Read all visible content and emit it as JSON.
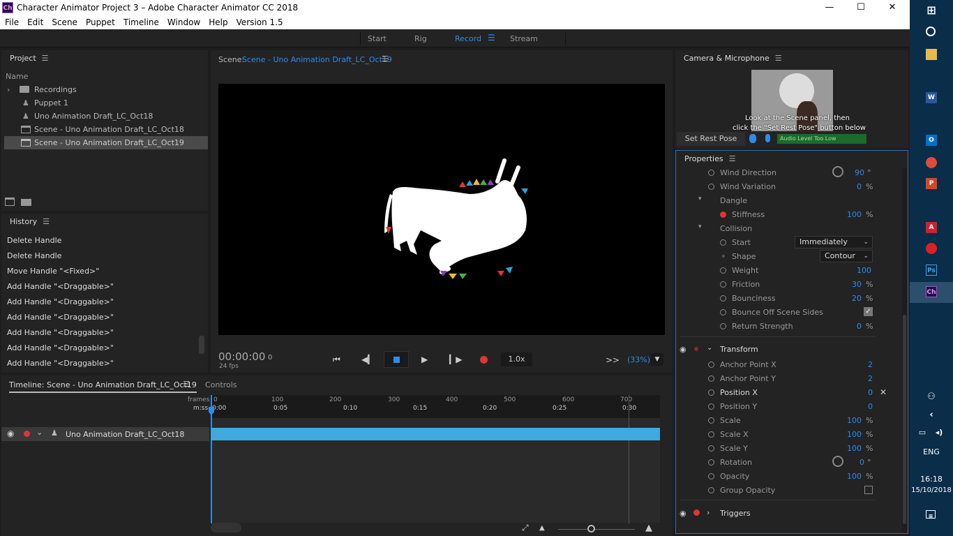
{
  "window": {
    "title": "Character Animator Project 3 – Adobe Character Animator CC 2018",
    "app_icon": "Ch",
    "buttons": {
      "minimize": "—",
      "maximize": "☐",
      "close": "✕"
    }
  },
  "menu": [
    "File",
    "Edit",
    "Scene",
    "Puppet",
    "Timeline",
    "Window",
    "Help",
    "Version 1.5"
  ],
  "workspaces": {
    "start": "Start",
    "rig": "Rig",
    "record": "Record",
    "stream": "Stream"
  },
  "project": {
    "title": "Project",
    "column": "Name",
    "items": [
      {
        "label": "Recordings",
        "type": "folder"
      },
      {
        "label": "Puppet 1",
        "type": "puppet"
      },
      {
        "label": "Uno Animation Draft_LC_Oct18",
        "type": "puppet"
      },
      {
        "label": "Scene - Uno Animation Draft_LC_Oct18",
        "type": "scene"
      },
      {
        "label": "Scene - Uno Animation Draft_LC_Oct19",
        "type": "scene",
        "selected": true
      }
    ]
  },
  "history": {
    "title": "History",
    "items": [
      "Delete Handle",
      "Delete Handle",
      "Move Handle \"<Fixed>\"",
      "Add Handle \"<Draggable>\"",
      "Add Handle \"<Draggable>\"",
      "Add Handle \"<Draggable>\"",
      "Add Handle \"<Draggable>\"",
      "Add Handle \"<Draggable>\"",
      "Add Handle \"<Draggable>\""
    ]
  },
  "scene": {
    "label": "Scene:",
    "name": "Scene - Uno Animation Draft_LC_Oct19",
    "timecode": "00:00:00",
    "frame": "0",
    "fps": "24 fps",
    "speed": "1.0x",
    "zoom": "(33%)",
    "more": ">>"
  },
  "camera": {
    "title": "Camera & Microphone",
    "hint_line1": "Look at the Scene panel, then",
    "hint_line2": "click the \"Set Rest Pose\" button below",
    "set_rest_pose": "Set Rest Pose",
    "audio_level": "Audio Level Too Low"
  },
  "properties": {
    "title": "Properties",
    "rows": {
      "wind_direction": {
        "label": "Wind Direction",
        "value": "90",
        "unit": "°"
      },
      "wind_variation": {
        "label": "Wind Variation",
        "value": "0",
        "unit": "%"
      },
      "dangle": {
        "label": "Dangle"
      },
      "stiffness": {
        "label": "Stiffness",
        "value": "100",
        "unit": "%"
      },
      "collision": {
        "label": "Collision"
      },
      "start": {
        "label": "Start",
        "value": "Immediately"
      },
      "shape": {
        "label": "Shape",
        "value": "Contour"
      },
      "weight": {
        "label": "Weight",
        "value": "100"
      },
      "friction": {
        "label": "Friction",
        "value": "30",
        "unit": "%"
      },
      "bounciness": {
        "label": "Bounciness",
        "value": "20",
        "unit": "%"
      },
      "bounce_off": {
        "label": "Bounce Off Scene Sides",
        "checked": true
      },
      "return_strength": {
        "label": "Return Strength",
        "value": "0",
        "unit": "%"
      },
      "transform": {
        "label": "Transform"
      },
      "anchor_x": {
        "label": "Anchor Point X",
        "value": "2"
      },
      "anchor_y": {
        "label": "Anchor Point Y",
        "value": "2"
      },
      "position_x": {
        "label": "Position X",
        "value": "0"
      },
      "position_y": {
        "label": "Position Y",
        "value": "0"
      },
      "scale": {
        "label": "Scale",
        "value": "100",
        "unit": "%"
      },
      "scale_x": {
        "label": "Scale X",
        "value": "100",
        "unit": "%"
      },
      "scale_y": {
        "label": "Scale Y",
        "value": "100",
        "unit": "%"
      },
      "rotation": {
        "label": "Rotation",
        "value": "0",
        "unit": "°"
      },
      "opacity": {
        "label": "Opacity",
        "value": "100",
        "unit": "%"
      },
      "group_opacity": {
        "label": "Group Opacity",
        "checked": false
      },
      "triggers": {
        "label": "Triggers"
      }
    }
  },
  "timeline": {
    "title": "Timeline: Scene - Uno Animation Draft_LC_Oct19",
    "controls_tab": "Controls",
    "frames_label": "frames",
    "mss_label": "m:ss",
    "frame_ticks": [
      "0",
      "100",
      "200",
      "300",
      "400",
      "500",
      "600",
      "700"
    ],
    "time_ticks": [
      "0:00",
      "0:05",
      "0:10",
      "0:15",
      "0:20",
      "0:25",
      "0:30"
    ],
    "track": "Uno Animation Draft_LC_Oct18"
  },
  "taskbar": {
    "time": "16:18",
    "date": "15/10/2018",
    "lang": "ENG"
  },
  "colors": {
    "accent": "#2d8ceb",
    "track": "#3fa9e0",
    "record": "#e23434"
  }
}
